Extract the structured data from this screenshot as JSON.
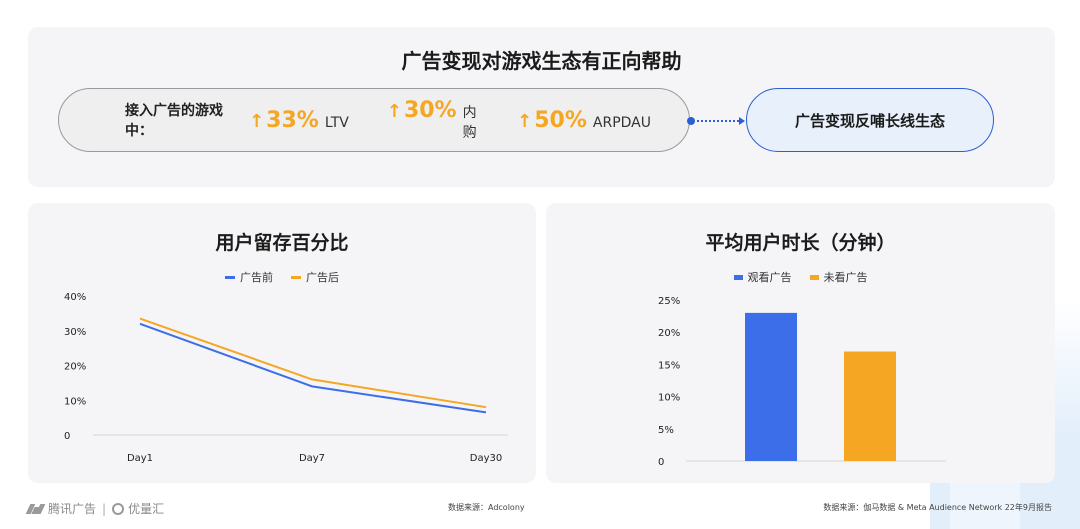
{
  "top": {
    "title": "广告变现对游戏生态有正向帮助",
    "lead": "接入广告的游戏中：",
    "stats": [
      {
        "arrow": "↑",
        "value": "33%",
        "label": "LTV"
      },
      {
        "arrow": "↑",
        "value": "30%",
        "label": "内购"
      },
      {
        "arrow": "↑",
        "value": "50%",
        "label": "ARPDAU"
      }
    ],
    "result": "广告变现反哺长线生态"
  },
  "retention": {
    "title": "用户留存百分比",
    "legend": [
      "广告前",
      "广告后"
    ],
    "source": "数据来源：Adcolony"
  },
  "duration": {
    "title": "平均用户时长（分钟）",
    "legend": [
      "观看广告",
      "未看广告"
    ],
    "source": "数据来源：伽马数据 & Meta Audience Network 22年9月报告"
  },
  "footer": {
    "brand1": "腾讯广告",
    "sep": "|",
    "brand2": "优量汇"
  },
  "colors": {
    "blue": "#3b6ee8",
    "orange": "#f5a623",
    "accent_border": "#2c5fd6"
  },
  "chart_data": [
    {
      "type": "line",
      "title": "用户留存百分比",
      "categories": [
        "Day1",
        "Day7",
        "Day30"
      ],
      "series": [
        {
          "name": "广告前",
          "values": [
            32,
            14,
            6.5
          ]
        },
        {
          "name": "广告后",
          "values": [
            33.5,
            16,
            8
          ]
        }
      ],
      "yticks": [
        "0",
        "10%",
        "20%",
        "30%",
        "40%"
      ],
      "ylim": [
        0,
        40
      ],
      "legend": "top-center",
      "grid": false
    },
    {
      "type": "bar",
      "title": "平均用户时长（分钟）",
      "categories": [
        "观看广告",
        "未看广告"
      ],
      "values": [
        23,
        17
      ],
      "yticks": [
        "0",
        "5%",
        "10%",
        "15%",
        "20%",
        "25%"
      ],
      "ylim": [
        0,
        25
      ],
      "legend": "top-center",
      "grid": false
    }
  ]
}
